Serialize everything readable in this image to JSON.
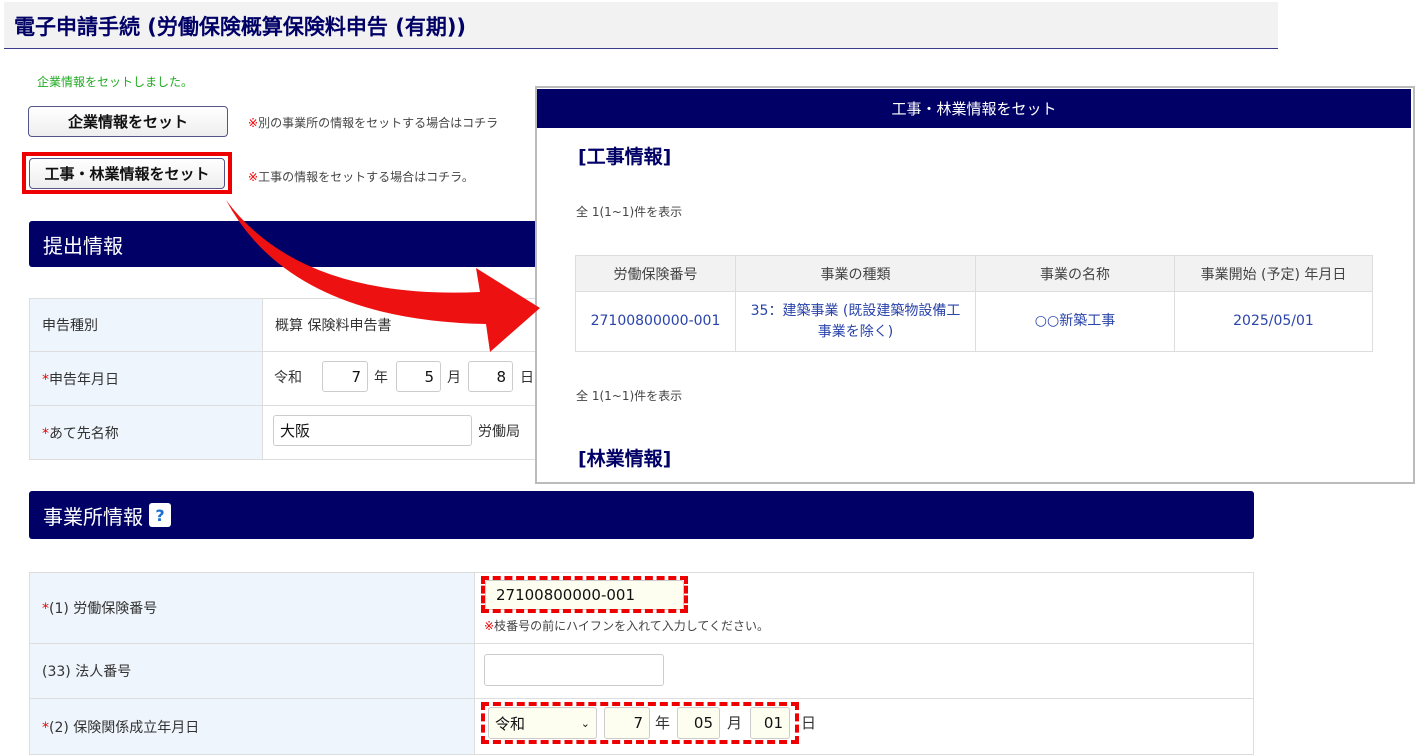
{
  "title": "電子申請手続 (労働保険概算保険料申告 (有期))",
  "message": "企業情報をセットしました。",
  "company_button": "企業情報をセット",
  "company_note": "別の事業所の情報をセットする場合はコチラ",
  "construction_button": "工事・林業情報をセット",
  "construction_note": "工事の情報をセットする場合はコチラ。",
  "note_mark": "※",
  "submission": {
    "heading": "提出情報",
    "rows": [
      {
        "label": "申告種別",
        "value": "概算 保険料申告書"
      },
      {
        "label": "申告年月日",
        "era": "令和",
        "year": "7",
        "year_unit": "年",
        "month": "5",
        "month_unit": "月",
        "day": "8",
        "day_unit": "日"
      },
      {
        "label": "あて先名称",
        "value": "大阪",
        "suffix": "労働局"
      }
    ]
  },
  "office": {
    "heading": "事業所情報",
    "help": "?",
    "rows": [
      {
        "label": "(1) 労働保険番号",
        "value": "27100800000-001",
        "note": "枝番号の前にハイフンを入れて入力してください。"
      },
      {
        "label": "(33) 法人番号",
        "value": ""
      },
      {
        "label": "(2) 保険関係成立年月日",
        "era": "令和",
        "year": "7",
        "year_unit": "年",
        "month": "05",
        "month_unit": "月",
        "day": "01",
        "day_unit": "日"
      }
    ]
  },
  "required_mark": "*",
  "modal": {
    "title": "工事・林業情報をセット",
    "construction_heading": "[工事情報]",
    "count_text": "全 1(1~1)件を表示",
    "columns": [
      "労働保険番号",
      "事業の種類",
      "事業の名称",
      "事業開始 (予定) 年月日"
    ],
    "rows": [
      [
        "27100800000-001",
        "35：建築事業 (既設建築物設備工事業を除く)",
        "○○新築工事",
        "2025/05/01"
      ]
    ],
    "forestry_heading": "[林業情報]"
  }
}
